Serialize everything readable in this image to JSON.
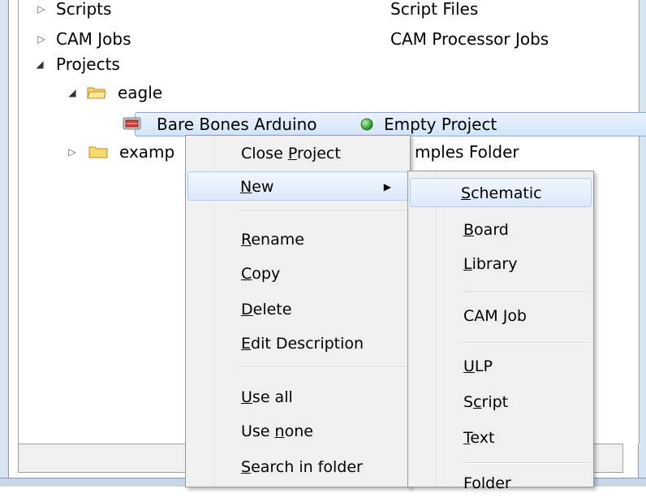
{
  "tree": {
    "rows": [
      {
        "label": "Scripts",
        "description": "Script Files"
      },
      {
        "label": "CAM Jobs",
        "description": "CAM Processor Jobs"
      },
      {
        "label": "Projects",
        "description": ""
      },
      {
        "label": "eagle",
        "description": ""
      },
      {
        "label": "Bare Bones Arduino",
        "description": "Empty Project"
      },
      {
        "label": "examp",
        "description": "mples Folder"
      }
    ]
  },
  "context_menu": {
    "items": [
      {
        "pre": "Close ",
        "key": "P",
        "post": "roject"
      },
      {
        "pre": "",
        "key": "N",
        "post": "ew"
      },
      {
        "pre": "",
        "key": "R",
        "post": "ename"
      },
      {
        "pre": "",
        "key": "C",
        "post": "opy"
      },
      {
        "pre": "",
        "key": "D",
        "post": "elete"
      },
      {
        "pre": "",
        "key": "E",
        "post": "dit Description"
      },
      {
        "pre": "",
        "key": "U",
        "post": "se all"
      },
      {
        "pre": "Use ",
        "key": "n",
        "post": "one"
      },
      {
        "pre": "",
        "key": "S",
        "post": "earch in folder"
      }
    ]
  },
  "submenu": {
    "items": [
      {
        "pre": "",
        "key": "S",
        "post": "chematic"
      },
      {
        "pre": "",
        "key": "B",
        "post": "oard"
      },
      {
        "pre": "",
        "key": "L",
        "post": "ibrary"
      },
      {
        "pre": "CAM ",
        "key": "J",
        "post": "ob"
      },
      {
        "pre": "",
        "key": "U",
        "post": "LP"
      },
      {
        "pre": "S",
        "key": "c",
        "post": "ript"
      },
      {
        "pre": "",
        "key": "T",
        "post": "ext"
      },
      {
        "pre": "Folder",
        "key": "",
        "post": ""
      }
    ]
  },
  "colors": {
    "selection": "#d1e4fa",
    "status_green": "#2e9e2e"
  }
}
